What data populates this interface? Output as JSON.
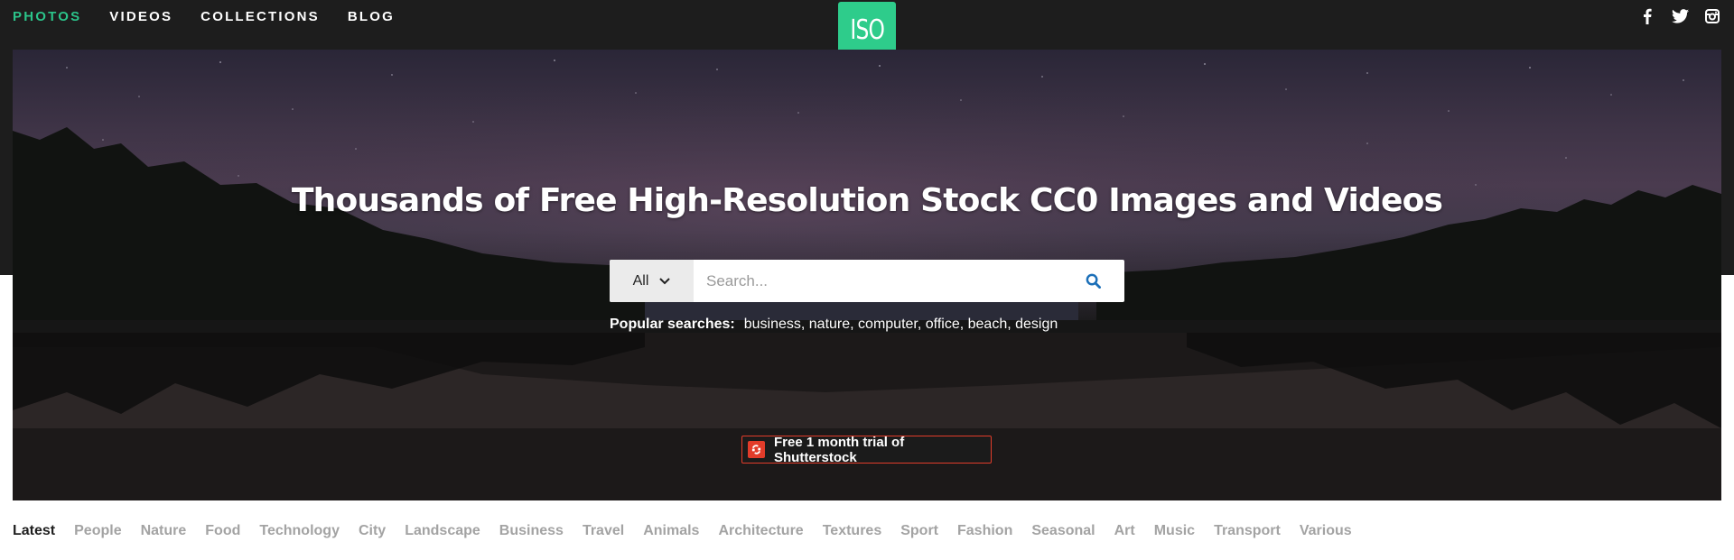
{
  "nav": {
    "items": [
      {
        "label": "PHOTOS",
        "active": true
      },
      {
        "label": "VIDEOS",
        "active": false
      },
      {
        "label": "COLLECTIONS",
        "active": false
      },
      {
        "label": "BLOG",
        "active": false
      }
    ],
    "accent": "#2bc48a"
  },
  "logo": {
    "text": "ISO",
    "color": "#2ecc8b"
  },
  "social": [
    {
      "icon": "facebook-icon"
    },
    {
      "icon": "twitter-icon"
    },
    {
      "icon": "instagram-icon"
    }
  ],
  "hero": {
    "title": "Thousands of Free High-Resolution Stock CC0 Images and Videos",
    "search": {
      "filter_value": "All",
      "placeholder": "Search...",
      "button_icon": "search-icon",
      "button_color": "#1b6fb8"
    },
    "popular": {
      "label": "Popular searches:",
      "links": [
        "business,",
        "nature,",
        "computer,",
        "office,",
        "beach,",
        "design"
      ]
    },
    "promo": {
      "text": "Free 1 month trial of Shutterstock",
      "icon": "shutterstock-icon",
      "color": "#e23c2a"
    }
  },
  "categories": [
    {
      "label": "Latest",
      "active": true
    },
    {
      "label": "People",
      "active": false
    },
    {
      "label": "Nature",
      "active": false
    },
    {
      "label": "Food",
      "active": false
    },
    {
      "label": "Technology",
      "active": false
    },
    {
      "label": "City",
      "active": false
    },
    {
      "label": "Landscape",
      "active": false
    },
    {
      "label": "Business",
      "active": false
    },
    {
      "label": "Travel",
      "active": false
    },
    {
      "label": "Animals",
      "active": false
    },
    {
      "label": "Architecture",
      "active": false
    },
    {
      "label": "Textures",
      "active": false
    },
    {
      "label": "Sport",
      "active": false
    },
    {
      "label": "Fashion",
      "active": false
    },
    {
      "label": "Seasonal",
      "active": false
    },
    {
      "label": "Art",
      "active": false
    },
    {
      "label": "Music",
      "active": false
    },
    {
      "label": "Transport",
      "active": false
    },
    {
      "label": "Various",
      "active": false
    }
  ]
}
